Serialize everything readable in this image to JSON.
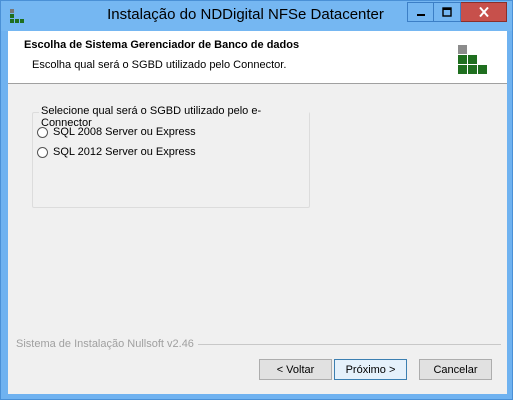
{
  "window": {
    "title": "Instalação do NDDigital NFSe Datacenter"
  },
  "header": {
    "title": "Escolha de Sistema Gerenciador de Banco de dados",
    "subtitle": "Escolha qual será o SGBD utilizado pelo Connector."
  },
  "group": {
    "label": "Selecione qual será o SGBD utilizado pelo e-Connector",
    "options": [
      {
        "label": "SQL 2008 Server ou Express",
        "selected": false
      },
      {
        "label": "SQL 2012 Server ou Express",
        "selected": false
      }
    ]
  },
  "footer": {
    "brand": "Sistema de Instalação Nullsoft v2.46",
    "back_label": "< Voltar",
    "next_label": "Próximo >",
    "cancel_label": "Cancelar"
  },
  "colors": {
    "titlebar": "#75b7f2",
    "close_button": "#c7504b",
    "logo_green": "#1f6f1f",
    "logo_gray": "#8c8c8c"
  },
  "icons": {
    "app": "nddigital-app-icon",
    "minimize": "minimize-icon",
    "maximize": "maximize-icon",
    "close": "close-icon",
    "header_logo": "nddigital-logo-icon"
  }
}
